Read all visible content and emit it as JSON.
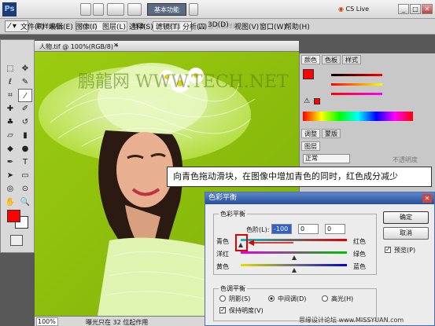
{
  "menu": [
    "文件(F)",
    "编辑(E)",
    "图像(I)",
    "图层(L)",
    "选择(S)",
    "滤镜(T)",
    "分析(A)",
    "3D(D)",
    "视图(V)",
    "窗口(W)",
    "帮助(H)"
  ],
  "workspace_button": "基本功能",
  "cs_live": "CS Live",
  "options": {
    "sample_size_label": "取样大小:",
    "sample_size_value": "取样点",
    "sample_label": "样本:",
    "sample_value": "所有图层",
    "show_ring_label": "显示取样环"
  },
  "document": {
    "title": "人物.tif @ 100%(RGB/8) *",
    "zoom": "100%",
    "status": "曝光只在 32 位起作用",
    "watermark": "鹏龍网 WWW.TECH.NET"
  },
  "panels": {
    "color_tabs": [
      "颜色",
      "色板",
      "样式"
    ],
    "adjust_tab": "调整",
    "masks_tab": "蒙版",
    "layers_tab": "图层",
    "blend_mode": "正常",
    "opacity_label": "不透明度"
  },
  "callout": "向青色拖动滑块，在图像中增加青色的同时，红色成分减少",
  "dialog": {
    "title": "色彩平衡",
    "color_balance_group": "色彩平衡",
    "levels_label": "色阶(L):",
    "levels": [
      "-100",
      "0",
      "0"
    ],
    "sliders": [
      {
        "left": "青色",
        "right": "红色",
        "value": -100
      },
      {
        "left": "洋红",
        "right": "绿色",
        "value": 0
      },
      {
        "left": "黄色",
        "right": "蓝色",
        "value": 0
      }
    ],
    "tone_group": "色调平衡",
    "tones": [
      "阴影(S)",
      "中间调(D)",
      "高光(H)"
    ],
    "selected_tone": 1,
    "preserve_label": "保持明度(V)",
    "ok": "确定",
    "cancel": "取消",
    "preview": "预览(P)",
    "preview_checked": true
  },
  "watermark_corner": "思缘设计论坛 www.MISSYUAN.com"
}
